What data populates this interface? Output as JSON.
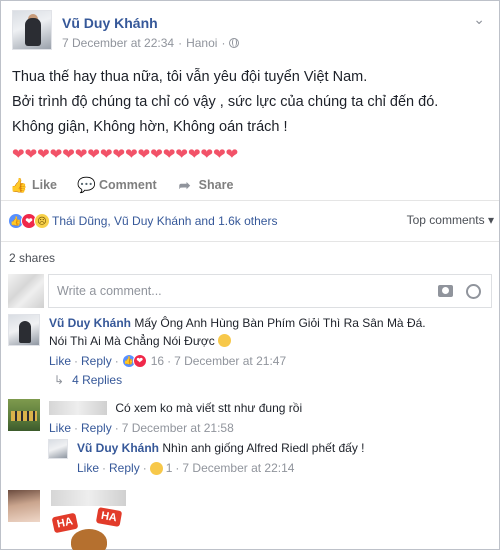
{
  "post": {
    "author": "Vũ Duy Khánh",
    "timestamp": "7 December at 22:34",
    "separator": "·",
    "location": "Hanoi",
    "lines": [
      "Thua thế hay thua nữa, tôi vẫn yêu đội tuyển Việt Nam.",
      "Bởi trình độ chúng ta chỉ có vậy , sức lực của chúng ta chỉ đến đó.",
      "Không giận, Không hờn, Không oán trách !"
    ],
    "hearts": "❤❤❤❤❤❤❤❤❤❤❤❤❤❤❤❤❤❤",
    "more_icon": "chevron-down-icon"
  },
  "actions": {
    "like": "Like",
    "comment": "Comment",
    "share": "Share"
  },
  "reactions": {
    "summary": "Thái Dũng, Vũ Duy Khánh and 1.6k others",
    "top_comments": "Top comments ▾",
    "shares": "2 shares"
  },
  "composer": {
    "placeholder": "Write a comment..."
  },
  "comments": [
    {
      "author": "Vũ Duy Khánh",
      "text_line1": "Mấy Ông Anh Hùng Bàn Phím Giỏi Thì Ra Sân Mà Đá.",
      "text_line2": "Nói Thì Ai Mà Chẳng Nói Được",
      "like": "Like",
      "reply": "Reply",
      "reaction_count": "16",
      "time": "7 December at 21:47",
      "replies": "4 Replies"
    },
    {
      "text": "Có xem ko mà viết stt như đung rồi",
      "like": "Like",
      "reply": "Reply",
      "time": "7 December at 21:58"
    },
    {
      "author": "Vũ Duy Khánh",
      "text": "Nhìn anh giống Alfred Riedl phết đấy !",
      "like": "Like",
      "reply": "Reply",
      "reaction_count": "1",
      "time": "7 December at 22:14"
    }
  ],
  "sticker": {
    "ha1": "HA",
    "ha2": "HA"
  }
}
